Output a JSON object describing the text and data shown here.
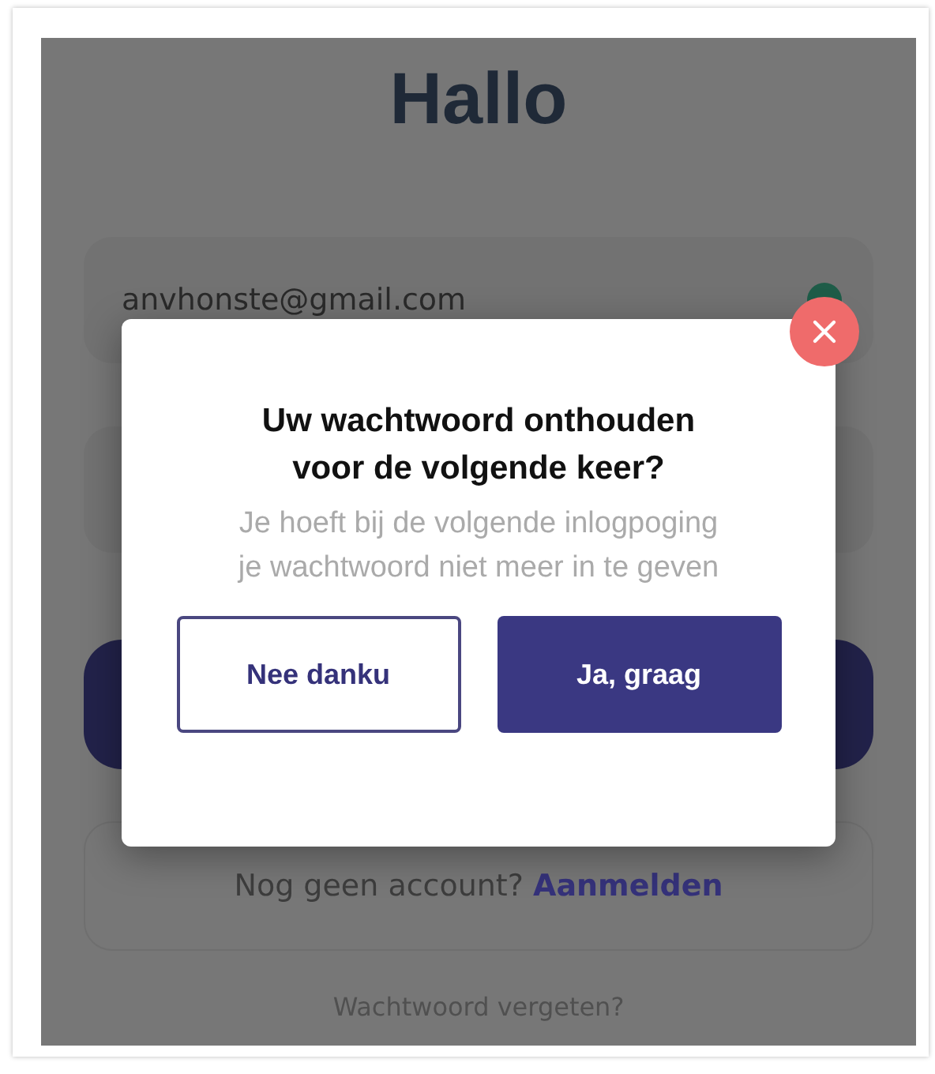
{
  "page": {
    "title": "Hallo"
  },
  "email_field": {
    "value": "anvhonste@gmail.com"
  },
  "signup": {
    "prompt": "Nog geen account?",
    "link": "Aanmelden"
  },
  "forgot_link": "Wachtwoord vergeten?",
  "dialog": {
    "title": "Uw wachtwoord onthouden voor de volgende keer?",
    "message": "Je hoeft bij de volgende inlogpoging je wachtwoord niet meer in te geven",
    "buttons": [
      {
        "label": "Nee danku",
        "kind": "secondary"
      },
      {
        "label": "Ja, graag",
        "kind": "primary"
      }
    ]
  }
}
